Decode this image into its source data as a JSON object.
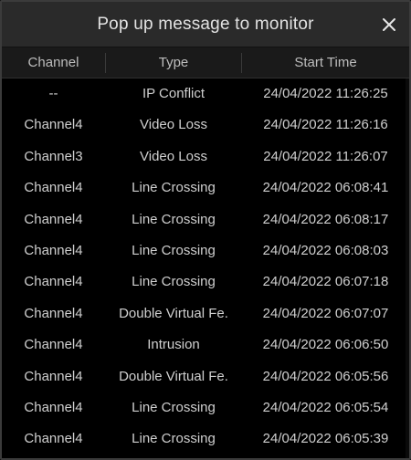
{
  "dialog": {
    "title": "Pop up message to monitor",
    "close_icon": "close-icon"
  },
  "table": {
    "headers": {
      "channel": "Channel",
      "type": "Type",
      "start_time": "Start Time"
    },
    "rows": [
      {
        "channel": "--",
        "type": "IP Conflict",
        "start_time": "24/04/2022 11:26:25"
      },
      {
        "channel": "Channel4",
        "type": "Video Loss",
        "start_time": "24/04/2022 11:26:16"
      },
      {
        "channel": "Channel3",
        "type": "Video Loss",
        "start_time": "24/04/2022 11:26:07"
      },
      {
        "channel": "Channel4",
        "type": "Line Crossing",
        "start_time": "24/04/2022 06:08:41"
      },
      {
        "channel": "Channel4",
        "type": "Line Crossing",
        "start_time": "24/04/2022 06:08:17"
      },
      {
        "channel": "Channel4",
        "type": "Line Crossing",
        "start_time": "24/04/2022 06:08:03"
      },
      {
        "channel": "Channel4",
        "type": "Line Crossing",
        "start_time": "24/04/2022 06:07:18"
      },
      {
        "channel": "Channel4",
        "type": "Double Virtual Fe.",
        "start_time": "24/04/2022 06:07:07"
      },
      {
        "channel": "Channel4",
        "type": "Intrusion",
        "start_time": "24/04/2022 06:06:50"
      },
      {
        "channel": "Channel4",
        "type": "Double Virtual Fe.",
        "start_time": "24/04/2022 06:05:56"
      },
      {
        "channel": "Channel4",
        "type": "Line Crossing",
        "start_time": "24/04/2022 06:05:54"
      },
      {
        "channel": "Channel4",
        "type": "Line Crossing",
        "start_time": "24/04/2022 06:05:39"
      }
    ]
  },
  "colors": {
    "background": "#000000",
    "titlebar": "#2a2a2a",
    "header": "#1a1a1a",
    "text": "#cfcfcf"
  }
}
